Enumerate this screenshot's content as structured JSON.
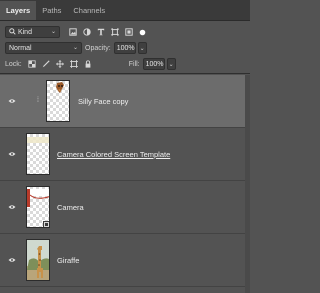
{
  "tabs": [
    {
      "label": "Layers",
      "active": true
    },
    {
      "label": "Paths",
      "active": false
    },
    {
      "label": "Channels",
      "active": false
    }
  ],
  "filter": {
    "kind_label": "Kind",
    "icons": [
      "image-filter-icon",
      "adjustment-filter-icon",
      "type-filter-icon",
      "shape-filter-icon",
      "smart-object-filter-icon",
      "filter-toggle-icon"
    ]
  },
  "blend": {
    "mode": "Normal",
    "opacity_label": "Opacity:",
    "opacity_value": "100%"
  },
  "lock": {
    "label": "Lock:",
    "icons": [
      "lock-transparent-pixels-icon",
      "lock-image-pixels-icon",
      "lock-position-icon",
      "lock-artboard-icon",
      "lock-all-icon"
    ],
    "fill_label": "Fill:",
    "fill_value": "100%"
  },
  "layers": [
    {
      "name": "Silly Face copy",
      "selected": true,
      "visible": true,
      "underlined": false
    },
    {
      "name": "Camera Colored Screen Template",
      "selected": false,
      "visible": true,
      "underlined": true
    },
    {
      "name": "Camera",
      "selected": false,
      "visible": true,
      "underlined": false
    },
    {
      "name": "Giraffe",
      "selected": false,
      "visible": true,
      "underlined": false
    }
  ],
  "colors": {
    "panel": "#535353",
    "selected_row": "#6c6c6c",
    "tab_bar": "#3a3a3a"
  }
}
